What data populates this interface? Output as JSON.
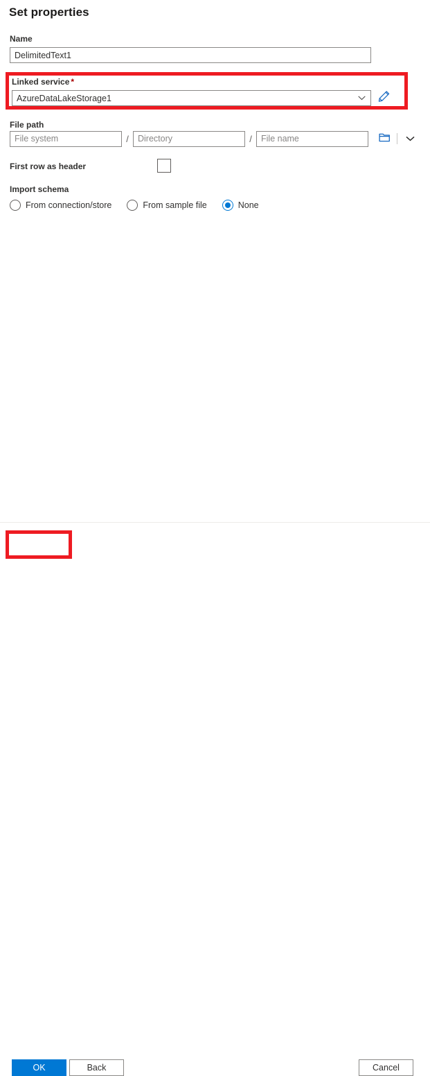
{
  "dialog": {
    "title": "Set properties"
  },
  "fields": {
    "name": {
      "label": "Name",
      "value": "DelimitedText1",
      "placeholder": ""
    },
    "linked_service": {
      "label": "Linked service",
      "required_marker": "*",
      "value": "AzureDataLakeStorage1",
      "placeholder": "",
      "caret_icon": "chevron-down-icon",
      "edit_icon": "pencil-icon"
    },
    "file_path": {
      "label": "File path",
      "file_system_placeholder": "File system",
      "file_system_value": "",
      "directory_placeholder": "Directory",
      "directory_value": "",
      "file_name_placeholder": "File name",
      "file_name_value": "",
      "separator": "/",
      "browse_icon": "folder-icon",
      "caret_icon": "chevron-down-icon"
    },
    "first_row_as_header": {
      "label": "First row as header",
      "checked": false
    },
    "import_schema": {
      "label": "Import schema",
      "options": [
        {
          "label": "From connection/store",
          "selected": false
        },
        {
          "label": "From sample file",
          "selected": false
        },
        {
          "label": "None",
          "selected": true
        }
      ]
    }
  },
  "footer": {
    "ok_label": "OK",
    "back_label": "Back",
    "cancel_label": "Cancel"
  },
  "colors": {
    "accent": "#0078d4",
    "highlight": "#ee1b22",
    "required": "#a80000",
    "border": "#8a8886",
    "text": "#323130"
  }
}
